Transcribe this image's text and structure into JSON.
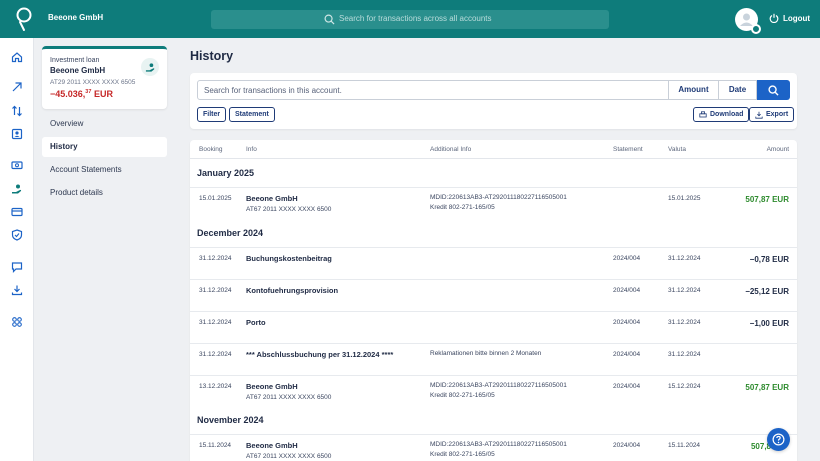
{
  "header": {
    "brand": "Beeone GmbH",
    "search_placeholder": "Search for transactions across all accounts",
    "logout": "Logout"
  },
  "rail": {
    "icons": [
      "home-icon",
      "transfer-icon",
      "swap-icon",
      "contacts-icon",
      "cash-icon",
      "loan-icon",
      "cards-icon",
      "shield-icon",
      "chat-icon",
      "download-icon",
      "apps-icon"
    ]
  },
  "account": {
    "type": "Investment loan",
    "name": "Beeone GmbH",
    "iban": "AT29 2011 XXXX XXXX 6505",
    "balance_main": "−45.036,",
    "balance_cents": "37",
    "balance_currency": "EUR"
  },
  "sidenav": {
    "items": [
      {
        "label": "Overview"
      },
      {
        "label": "History"
      },
      {
        "label": "Account Statements"
      },
      {
        "label": "Product details"
      }
    ]
  },
  "page": {
    "title": "History"
  },
  "filters": {
    "search_placeholder": "Search for transactions in this account.",
    "sort_amount": "Amount",
    "sort_date": "Date",
    "filter": "Filter",
    "statement": "Statement",
    "download": "Download",
    "export": "Export"
  },
  "table": {
    "headers": {
      "booking": "Booking",
      "info": "Info",
      "additional": "Additional Info",
      "statement": "Statement",
      "valuta": "Valuta",
      "amount": "Amount"
    },
    "groups": [
      {
        "month": "January 2025",
        "rows": [
          {
            "booking": "15.01.2025",
            "info": "Beeone GmbH",
            "info_sub": "AT67 2011 XXXX XXXX 6500",
            "add1": "MDID:220613AB3-AT292011180227116505001",
            "add2": "Kredit 802-271-165/05",
            "statement": "",
            "valuta": "15.01.2025",
            "amount": "507,87 EUR",
            "sign": "pos"
          }
        ]
      },
      {
        "month": "December 2024",
        "rows": [
          {
            "booking": "31.12.2024",
            "info": "Buchungskostenbeitrag",
            "info_sub": "",
            "add1": "",
            "add2": "",
            "statement": "2024/004",
            "valuta": "31.12.2024",
            "amount": "−0,78 EUR",
            "sign": "neg"
          },
          {
            "booking": "31.12.2024",
            "info": "Kontofuehrungsprovision",
            "info_sub": "",
            "add1": "",
            "add2": "",
            "statement": "2024/004",
            "valuta": "31.12.2024",
            "amount": "−25,12 EUR",
            "sign": "neg"
          },
          {
            "booking": "31.12.2024",
            "info": "Porto",
            "info_sub": "",
            "add1": "",
            "add2": "",
            "statement": "2024/004",
            "valuta": "31.12.2024",
            "amount": "−1,00 EUR",
            "sign": "neg"
          },
          {
            "booking": "31.12.2024",
            "info": "*** Abschlussbuchung per 31.12.2024 ****",
            "info_sub": "",
            "add1": "Reklamationen bitte binnen 2 Monaten",
            "add2": "",
            "statement": "2024/004",
            "valuta": "31.12.2024",
            "amount": "",
            "sign": "neg"
          },
          {
            "booking": "13.12.2024",
            "info": "Beeone GmbH",
            "info_sub": "AT67 2011 XXXX XXXX 6500",
            "add1": "MDID:220613AB3-AT292011180227116505001",
            "add2": "Kredit 802-271-165/05",
            "statement": "2024/004",
            "valuta": "15.12.2024",
            "amount": "507,87 EUR",
            "sign": "pos"
          }
        ]
      },
      {
        "month": "November 2024",
        "rows": [
          {
            "booking": "15.11.2024",
            "info": "Beeone GmbH",
            "info_sub": "AT67 2011 XXXX XXXX 6500",
            "add1": "MDID:220613AB3-AT292011180227116505001",
            "add2": "Kredit 802-271-165/05",
            "statement": "2024/004",
            "valuta": "15.11.2024",
            "amount": "507,8",
            "sign": "pos"
          }
        ]
      }
    ]
  },
  "colors": {
    "primary": "#0e7c7b",
    "accent": "#1c63c7",
    "negative_balance": "#c62828",
    "positive": "#2e8b2e"
  }
}
